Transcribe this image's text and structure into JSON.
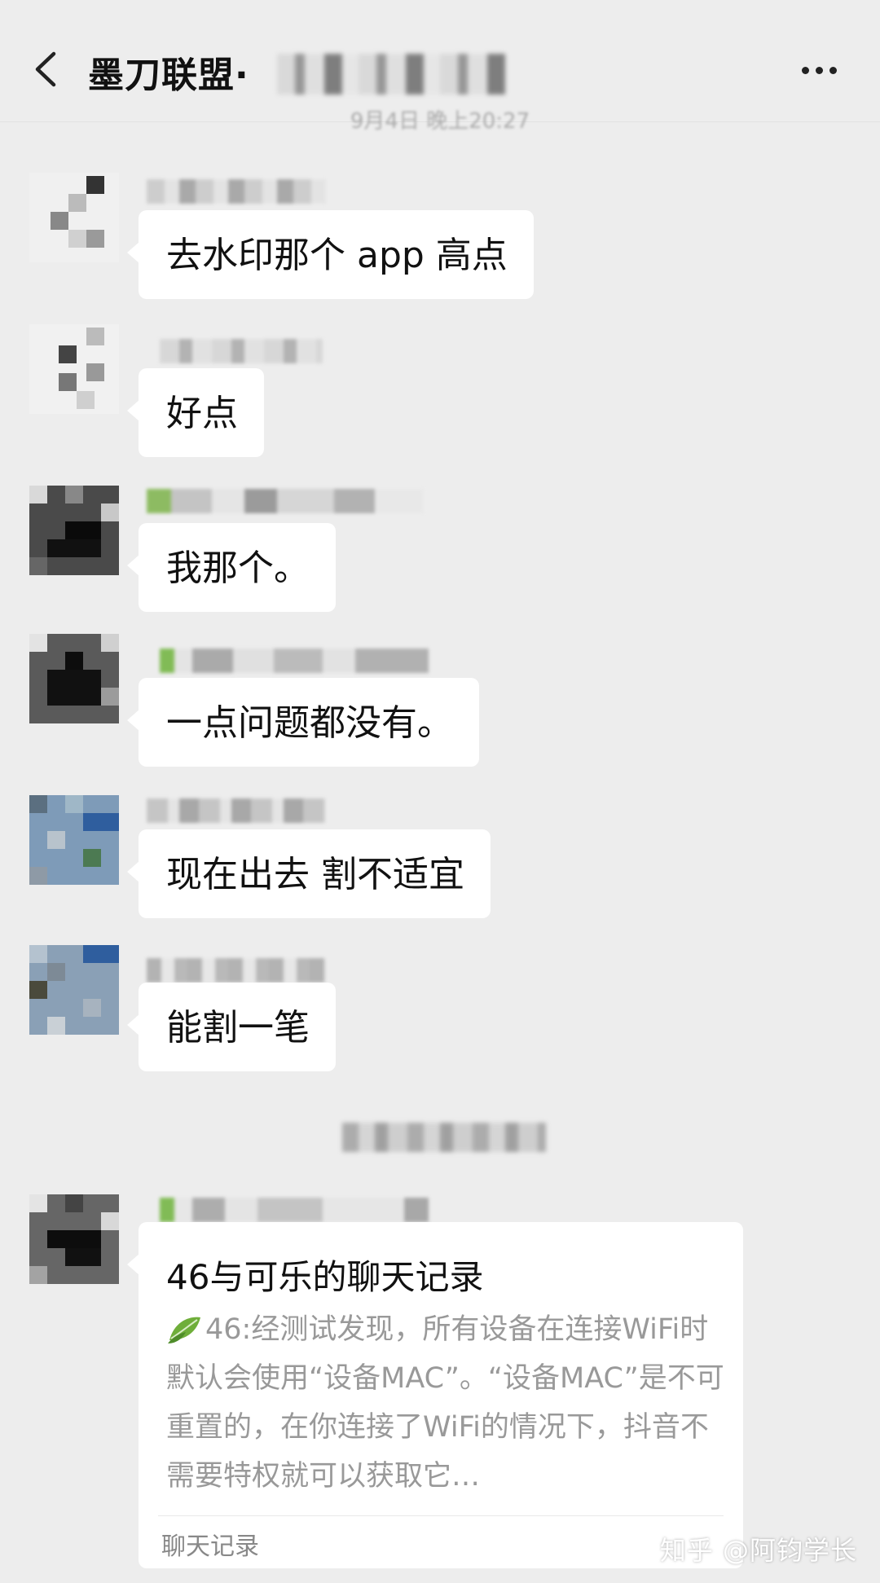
{
  "header": {
    "title": "墨刀联盟·",
    "timestamp": "9月4日 晚上20:27"
  },
  "messages": [
    {
      "text": "去水印那个 app 高点"
    },
    {
      "text": "好点"
    },
    {
      "text": "我那个。"
    },
    {
      "text": "一点问题都没有。"
    },
    {
      "text": "现在出去 割不适宜"
    },
    {
      "text": "能割一笔"
    }
  ],
  "chat_record_card": {
    "title": "46与可乐的聊天记录",
    "body": "46:经测试发现，所有设备在连接WiFi时默认会使用“设备MAC”。“设备MAC”是不可重置的，在你连接了WiFi的情况下，抖音不需要特权就可以获取它…",
    "footer": "聊天记录"
  },
  "watermark": "知乎 @阿钧学长"
}
